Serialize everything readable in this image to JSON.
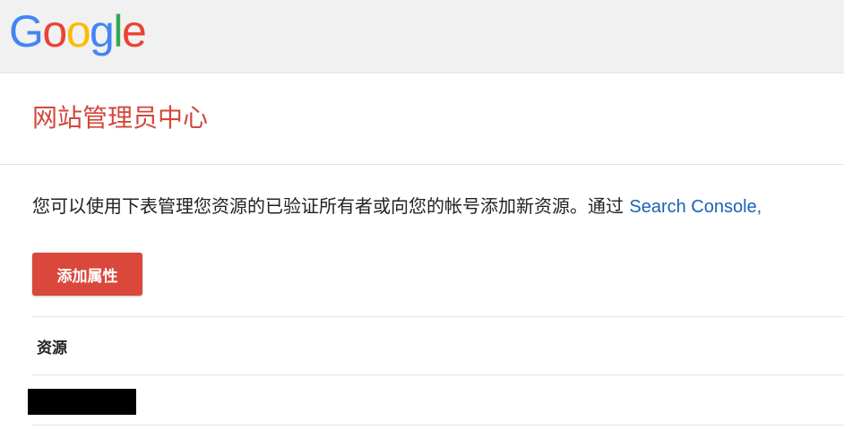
{
  "header": {
    "logo": {
      "letters": [
        {
          "char": "G",
          "color": "#4285F4"
        },
        {
          "char": "o",
          "color": "#EA4335"
        },
        {
          "char": "o",
          "color": "#FBBC05"
        },
        {
          "char": "g",
          "color": "#4285F4"
        },
        {
          "char": "l",
          "color": "#34A853"
        },
        {
          "char": "e",
          "color": "#EA4335"
        }
      ]
    }
  },
  "main": {
    "title": "网站管理员中心",
    "description": {
      "text": "您可以使用下表管理您资源的已验证所有者或向您的帐号添加新资源。通过 ",
      "link": "Search Console,"
    },
    "add_button_label": "添加属性",
    "table": {
      "column_header": "资源",
      "rows": [
        {
          "redacted": true
        }
      ]
    }
  },
  "colors": {
    "title": "#d2473a",
    "button": "#d9483b",
    "link": "#1a62b3",
    "header_bg": "#f1f1f1"
  }
}
